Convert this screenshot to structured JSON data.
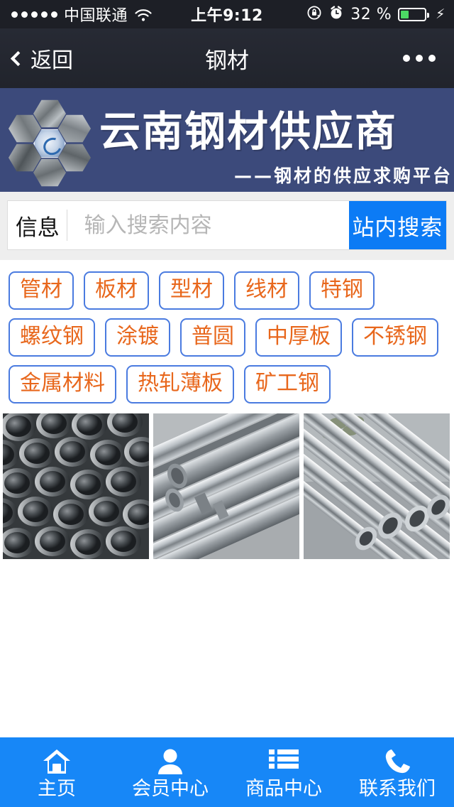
{
  "status_bar": {
    "signal_dots": 5,
    "carrier": "中国联通",
    "wifi_icon": "wifi-icon",
    "time": "上午9:12",
    "rotation_lock_icon": "rotation-lock-icon",
    "alarm_icon": "alarm-clock-icon",
    "battery_percent": "32 %",
    "battery_level": 35,
    "charging_icon": "lightning-bolt-icon",
    "colors": {
      "background": "#1d1f26",
      "battery_fill": "#4cd964"
    }
  },
  "nav_bar": {
    "back_label": "返回",
    "back_icon": "chevron-left-icon",
    "title": "钢材",
    "more_icon": "more-dots-icon",
    "colors": {
      "background": "#23262f",
      "text": "#ffffff"
    }
  },
  "banner": {
    "logo_icon": "steel-hexagon-logo",
    "title": "云南钢材供应商",
    "subtitle": "——钢材的供应求购平台",
    "colors": {
      "background": "#3c4a7b",
      "text": "#ffffff"
    }
  },
  "search": {
    "type_label": "信息",
    "placeholder": "输入搜索内容",
    "value": "",
    "button_label": "站内搜索",
    "colors": {
      "button": "#0c7bf5",
      "panel": "#eeeeee"
    }
  },
  "categories": {
    "colors": {
      "text": "#e8671c",
      "border": "#4a7be0"
    },
    "items": [
      {
        "label": "管材"
      },
      {
        "label": "板材"
      },
      {
        "label": "型材"
      },
      {
        "label": "线材"
      },
      {
        "label": "特钢"
      },
      {
        "label": "螺纹钢"
      },
      {
        "label": "涂镀"
      },
      {
        "label": "普圆"
      },
      {
        "label": "中厚板"
      },
      {
        "label": "不锈钢"
      },
      {
        "label": "金属材料"
      },
      {
        "label": "热轧薄板"
      },
      {
        "label": "矿工钢"
      }
    ]
  },
  "gallery": {
    "items": [
      {
        "alt": "stacked-steel-pipes-photo"
      },
      {
        "alt": "polished-steel-bars-photo"
      },
      {
        "alt": "stainless-steel-tubes-photo"
      }
    ]
  },
  "tabbar": {
    "colors": {
      "background": "#1787f7",
      "text": "#ffffff"
    },
    "items": [
      {
        "label": "主页",
        "icon": "home-icon"
      },
      {
        "label": "会员中心",
        "icon": "user-icon"
      },
      {
        "label": "商品中心",
        "icon": "list-icon"
      },
      {
        "label": "联系我们",
        "icon": "phone-icon"
      }
    ]
  }
}
